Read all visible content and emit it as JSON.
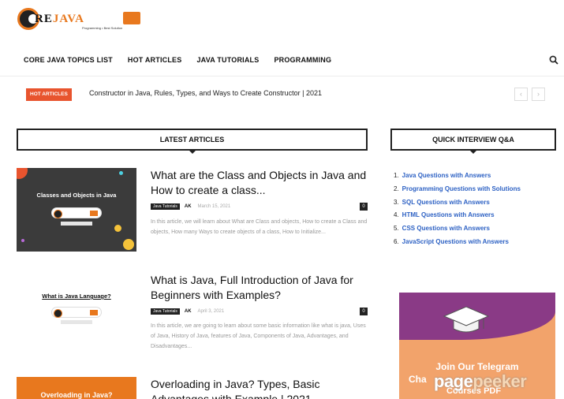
{
  "logo": {
    "text_main": "RE",
    "text_accent": "JAVA",
    "tagline": "Programming • Best Solution"
  },
  "nav": {
    "items": [
      "CORE JAVA TOPICS LIST",
      "HOT ARTICLES",
      "JAVA TUTORIALS",
      "PROGRAMMING"
    ],
    "search_icon": "search-icon"
  },
  "ticker": {
    "badge": "HOT ARTICLES",
    "text": "Constructor in Java, Rules, Types, and Ways to Create Constructor | 2021",
    "prev": "‹",
    "next": "›"
  },
  "sections": {
    "latest": "LATEST ARTICLES",
    "quick": "QUICK INTERVIEW Q&A"
  },
  "articles": [
    {
      "thumb_title": "Classes and Objects in Java",
      "title": "What are the Class and Objects in Java and How to create a class...",
      "category": "Java Tutorials",
      "author": "AK",
      "date": "March 15, 2021",
      "comments": "0",
      "excerpt": "In this article, we will learn about What are Class and objects, How to create a Class and objects, How many Ways to create objects of a class, How to Initialize..."
    },
    {
      "thumb_title": "What is Java Language?",
      "title": "What is Java, Full Introduction of Java for Beginners with Examples?",
      "category": "Java Tutorials",
      "author": "AK",
      "date": "April 3, 2021",
      "comments": "0",
      "excerpt": "In this article, we are going to learn about some basic information like what is java, Uses of Java, History of Java, features of Java, Components of Java, Advantages, and Disadvantages..."
    },
    {
      "thumb_title": "Overloading in Java?",
      "title": "Overloading in Java? Types, Basic Advantages with Example | 2021"
    }
  ],
  "quick_list": [
    {
      "num": "1.",
      "label": "Java Questions with Answers"
    },
    {
      "num": "2.",
      "label": "Programming Questions with Solutions"
    },
    {
      "num": "3.",
      "label": "SQL Questions with Answers"
    },
    {
      "num": "4.",
      "label": "HTML Questions with Answers"
    },
    {
      "num": "5.",
      "label": "CSS Questions with Answers"
    },
    {
      "num": "6.",
      "label": "JavaScript Questions with Answers"
    }
  ],
  "ad": {
    "line1": "Join Our Telegram",
    "line2": "Cha",
    "line3": "Courses PDF"
  },
  "watermark": {
    "part1": "page",
    "part2": "peeker"
  },
  "colors": {
    "accent": "#e8542e",
    "brand_orange": "#e8781e",
    "link_blue": "#2e62c4"
  }
}
